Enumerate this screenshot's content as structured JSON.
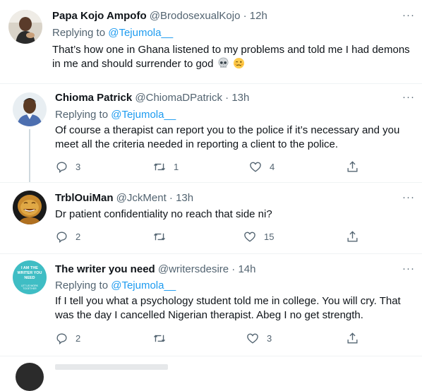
{
  "tweets": [
    {
      "name": "Papa Kojo Ampofo",
      "handle": "@BrodosexualKojo",
      "sep": " · ",
      "time": "12h",
      "replying_prefix": "Replying to ",
      "replying_to": "@Tejumola__",
      "text": "That’s how one in Ghana listened to my problems and told me I had demons in me and should surrender to god",
      "emojis": [
        "skull",
        "woozy-face"
      ]
    },
    {
      "name": "Chioma Patrick",
      "handle": "@ChiomaDPatrick",
      "sep": " · ",
      "time": "13h",
      "replying_prefix": "Replying to ",
      "replying_to": "@Tejumola__",
      "text": "Of course a therapist can report you to the police if it’s necessary and you meet all the criteria needed in reporting a client to the police.",
      "replies": "3",
      "retweets": "1",
      "likes": "4"
    },
    {
      "name": "TrblOuiMan",
      "handle": "@JckMent",
      "sep": " · ",
      "time": "13h",
      "text": "Dr patient confidentiality no reach that side ni?",
      "replies": "2",
      "retweets": "",
      "likes": "15"
    },
    {
      "name": "The writer you need",
      "handle": "@writersdesire",
      "sep": " · ",
      "time": "14h",
      "replying_prefix": "Replying to ",
      "replying_to": "@Tejumola__",
      "text": "If I tell you what a psychology student told me in college. You will cry. That was the day I cancelled Nigerian therapist. Abeg I no get strength.",
      "replies": "2",
      "retweets": "",
      "likes": "3",
      "avatar_text": "I AM THE WRITER YOU NEED",
      "avatar_subtext": "LET US WORK TOGETHER"
    }
  ],
  "more_label": "···",
  "colors": {
    "accent": "#1d9bf0",
    "secondary_text": "#536471",
    "divider": "#eff3f4",
    "avatar_writer_bg": "#3fbdc4"
  },
  "icons": [
    "reply-icon",
    "retweet-icon",
    "like-icon",
    "share-icon",
    "more-icon"
  ]
}
